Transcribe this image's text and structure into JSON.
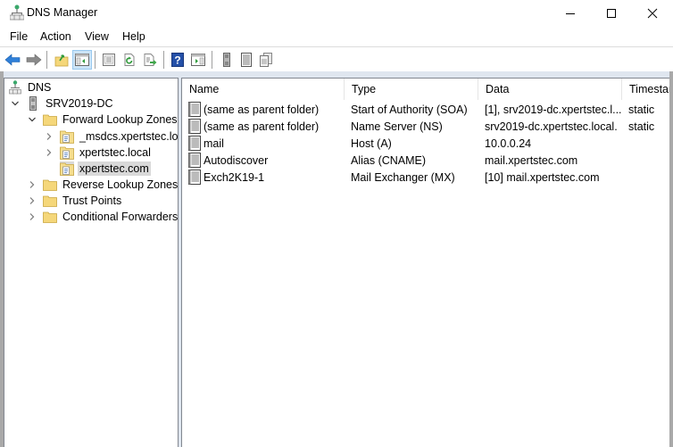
{
  "window": {
    "title": "DNS Manager",
    "controls": {
      "minimize": "minimize",
      "maximize": "maximize",
      "close": "close"
    }
  },
  "menu": {
    "items": [
      {
        "label": "File"
      },
      {
        "label": "Action"
      },
      {
        "label": "View"
      },
      {
        "label": "Help"
      }
    ]
  },
  "toolbar": {
    "buttons": [
      {
        "icon": "back-arrow-icon",
        "tooltip": "Back"
      },
      {
        "icon": "forward-arrow-icon",
        "tooltip": "Forward"
      },
      {
        "icon": "up-folder-icon",
        "tooltip": "Up one level"
      },
      {
        "icon": "show-hide-console-tree-icon",
        "tooltip": "Show/Hide Console Tree",
        "active": true
      },
      {
        "icon": "properties-icon",
        "tooltip": "Properties"
      },
      {
        "icon": "refresh-icon",
        "tooltip": "Refresh"
      },
      {
        "icon": "export-list-icon",
        "tooltip": "Export List"
      },
      {
        "icon": "help-icon",
        "tooltip": "Help"
      },
      {
        "icon": "show-hide-action-pane-icon",
        "tooltip": "Show/Hide Action Pane"
      },
      {
        "icon": "server-icon",
        "tooltip": "Server"
      },
      {
        "icon": "record-icon",
        "tooltip": "New Host"
      },
      {
        "icon": "copy-record-icon",
        "tooltip": "New Record"
      }
    ]
  },
  "tree": {
    "items": [
      {
        "label": "DNS",
        "level": 0,
        "expander": "none",
        "icon": "dns-icon"
      },
      {
        "label": "SRV2019-DC",
        "level": 1,
        "expander": "expanded",
        "icon": "server-icon"
      },
      {
        "label": "Forward Lookup Zones",
        "level": 2,
        "expander": "expanded",
        "icon": "folder-icon"
      },
      {
        "label": "_msdcs.xpertstec.local",
        "level": 3,
        "expander": "collapsed",
        "icon": "zone-icon"
      },
      {
        "label": "xpertstec.local",
        "level": 3,
        "expander": "collapsed",
        "icon": "zone-icon"
      },
      {
        "label": "xpertstec.com",
        "level": 3,
        "expander": "none",
        "icon": "zone-icon",
        "selected": true
      },
      {
        "label": "Reverse Lookup Zones",
        "level": 2,
        "expander": "collapsed",
        "icon": "folder-icon"
      },
      {
        "label": "Trust Points",
        "level": 2,
        "expander": "collapsed",
        "icon": "folder-icon"
      },
      {
        "label": "Conditional Forwarders",
        "level": 2,
        "expander": "collapsed",
        "icon": "folder-icon"
      }
    ]
  },
  "list": {
    "columns": [
      {
        "label": "Name"
      },
      {
        "label": "Type"
      },
      {
        "label": "Data"
      },
      {
        "label": "Timestamp"
      }
    ],
    "rows": [
      {
        "name": "(same as parent folder)",
        "type": "Start of Authority (SOA)",
        "data": "[1], srv2019-dc.xpertstec.l...",
        "timestamp": "static"
      },
      {
        "name": "(same as parent folder)",
        "type": "Name Server (NS)",
        "data": "srv2019-dc.xpertstec.local.",
        "timestamp": "static"
      },
      {
        "name": "mail",
        "type": "Host (A)",
        "data": "10.0.0.24",
        "timestamp": ""
      },
      {
        "name": "Autodiscover",
        "type": "Alias (CNAME)",
        "data": "mail.xpertstec.com",
        "timestamp": ""
      },
      {
        "name": "Exch2K19-1",
        "type": "Mail Exchanger (MX)",
        "data": "[10]  mail.xpertstec.com",
        "timestamp": ""
      }
    ]
  },
  "colors": {
    "selection": "#d9d9d9",
    "toolbar_active": "#cce4f7",
    "back_arrow": "#2f7fd8",
    "help_blue": "#2450a8",
    "folder": "#f5d77a"
  }
}
